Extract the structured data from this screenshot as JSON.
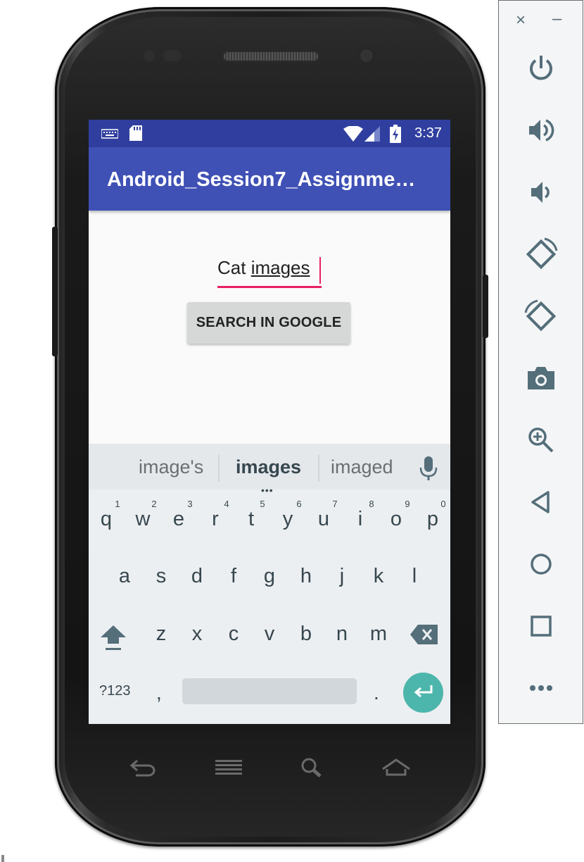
{
  "status_bar": {
    "time": "3:37"
  },
  "app_bar": {
    "title": "Android_Session7_Assignme…"
  },
  "search_field": {
    "value_plain": "Cat ",
    "value_composing": "images"
  },
  "search_button": {
    "label": "SEARCH IN GOOGLE"
  },
  "keyboard": {
    "suggestions": [
      "image's",
      "images",
      "imaged"
    ],
    "row1": [
      "q",
      "w",
      "e",
      "r",
      "t",
      "y",
      "u",
      "i",
      "o",
      "p"
    ],
    "row1_hints": [
      "1",
      "2",
      "3",
      "4",
      "5",
      "6",
      "7",
      "8",
      "9",
      "0"
    ],
    "row2": [
      "a",
      "s",
      "d",
      "f",
      "g",
      "h",
      "j",
      "k",
      "l"
    ],
    "row3": [
      "z",
      "x",
      "c",
      "v",
      "b",
      "n",
      "m"
    ],
    "symbols_key": "?123",
    "comma": ",",
    "period": "."
  },
  "emulator_sidebar": {
    "controls": [
      "power-icon",
      "volume-up-icon",
      "volume-down-icon",
      "rotate-left-icon",
      "rotate-right-icon",
      "camera-icon",
      "zoom-icon",
      "back-icon",
      "home-icon",
      "overview-icon",
      "more-icon"
    ]
  },
  "colors": {
    "status_bar": "#303f9f",
    "app_bar": "#3f51b5",
    "accent": "#e91e63",
    "enter_key": "#4db6ac",
    "sidebar_icon": "#546e7a"
  }
}
